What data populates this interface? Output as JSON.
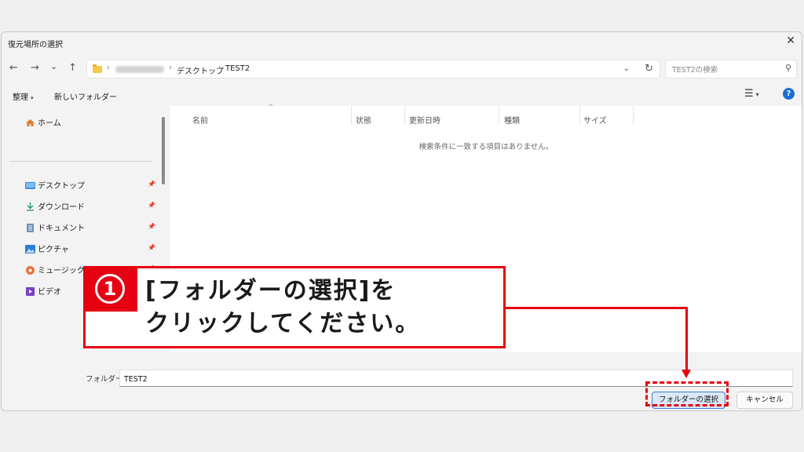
{
  "window": {
    "title": "復元場所の選択",
    "close_glyph": "✕"
  },
  "nav": {
    "back": "←",
    "forward": "→",
    "recent": "⌄",
    "up": "↑"
  },
  "address": {
    "breadcrumbs": [
      "デスクトップ",
      "TEST2"
    ],
    "separator": "›",
    "dropdown_glyph": "⌄",
    "refresh_glyph": "↻"
  },
  "search": {
    "placeholder": "TEST2の検索",
    "icon_glyph": "⚲"
  },
  "commands": {
    "organize": "整理",
    "new_folder": "新しいフォルダー",
    "caret": "▾",
    "view_glyph": "☰",
    "help_glyph": "?"
  },
  "sidebar": {
    "pin_glyph": "📌",
    "items": [
      {
        "label": "ホーム",
        "icon": "home-icon",
        "pinned": false
      },
      {
        "label": "デスクトップ",
        "icon": "desktop-icon",
        "pinned": true
      },
      {
        "label": "ダウンロード",
        "icon": "download-icon",
        "pinned": true
      },
      {
        "label": "ドキュメント",
        "icon": "documents-icon",
        "pinned": true
      },
      {
        "label": "ピクチャ",
        "icon": "pictures-icon",
        "pinned": true
      },
      {
        "label": "ミュージック",
        "icon": "music-icon",
        "pinned": true
      },
      {
        "label": "ビデオ",
        "icon": "videos-icon",
        "pinned": false
      }
    ]
  },
  "file_list": {
    "columns": [
      "名前",
      "状態",
      "更新日時",
      "種類",
      "サイズ"
    ],
    "sort_glyph": "^",
    "empty_message": "検索条件に一致する項目はありません。"
  },
  "footer": {
    "folder_label": "フォルダー:",
    "folder_value": "TEST2",
    "select_button": "フォルダーの選択",
    "cancel_button": "キャンセル"
  },
  "annotation": {
    "step_number": "1",
    "line1": "[フォルダーの選択]を",
    "line2": "クリックしてください。",
    "accent_color": "#e60012"
  }
}
